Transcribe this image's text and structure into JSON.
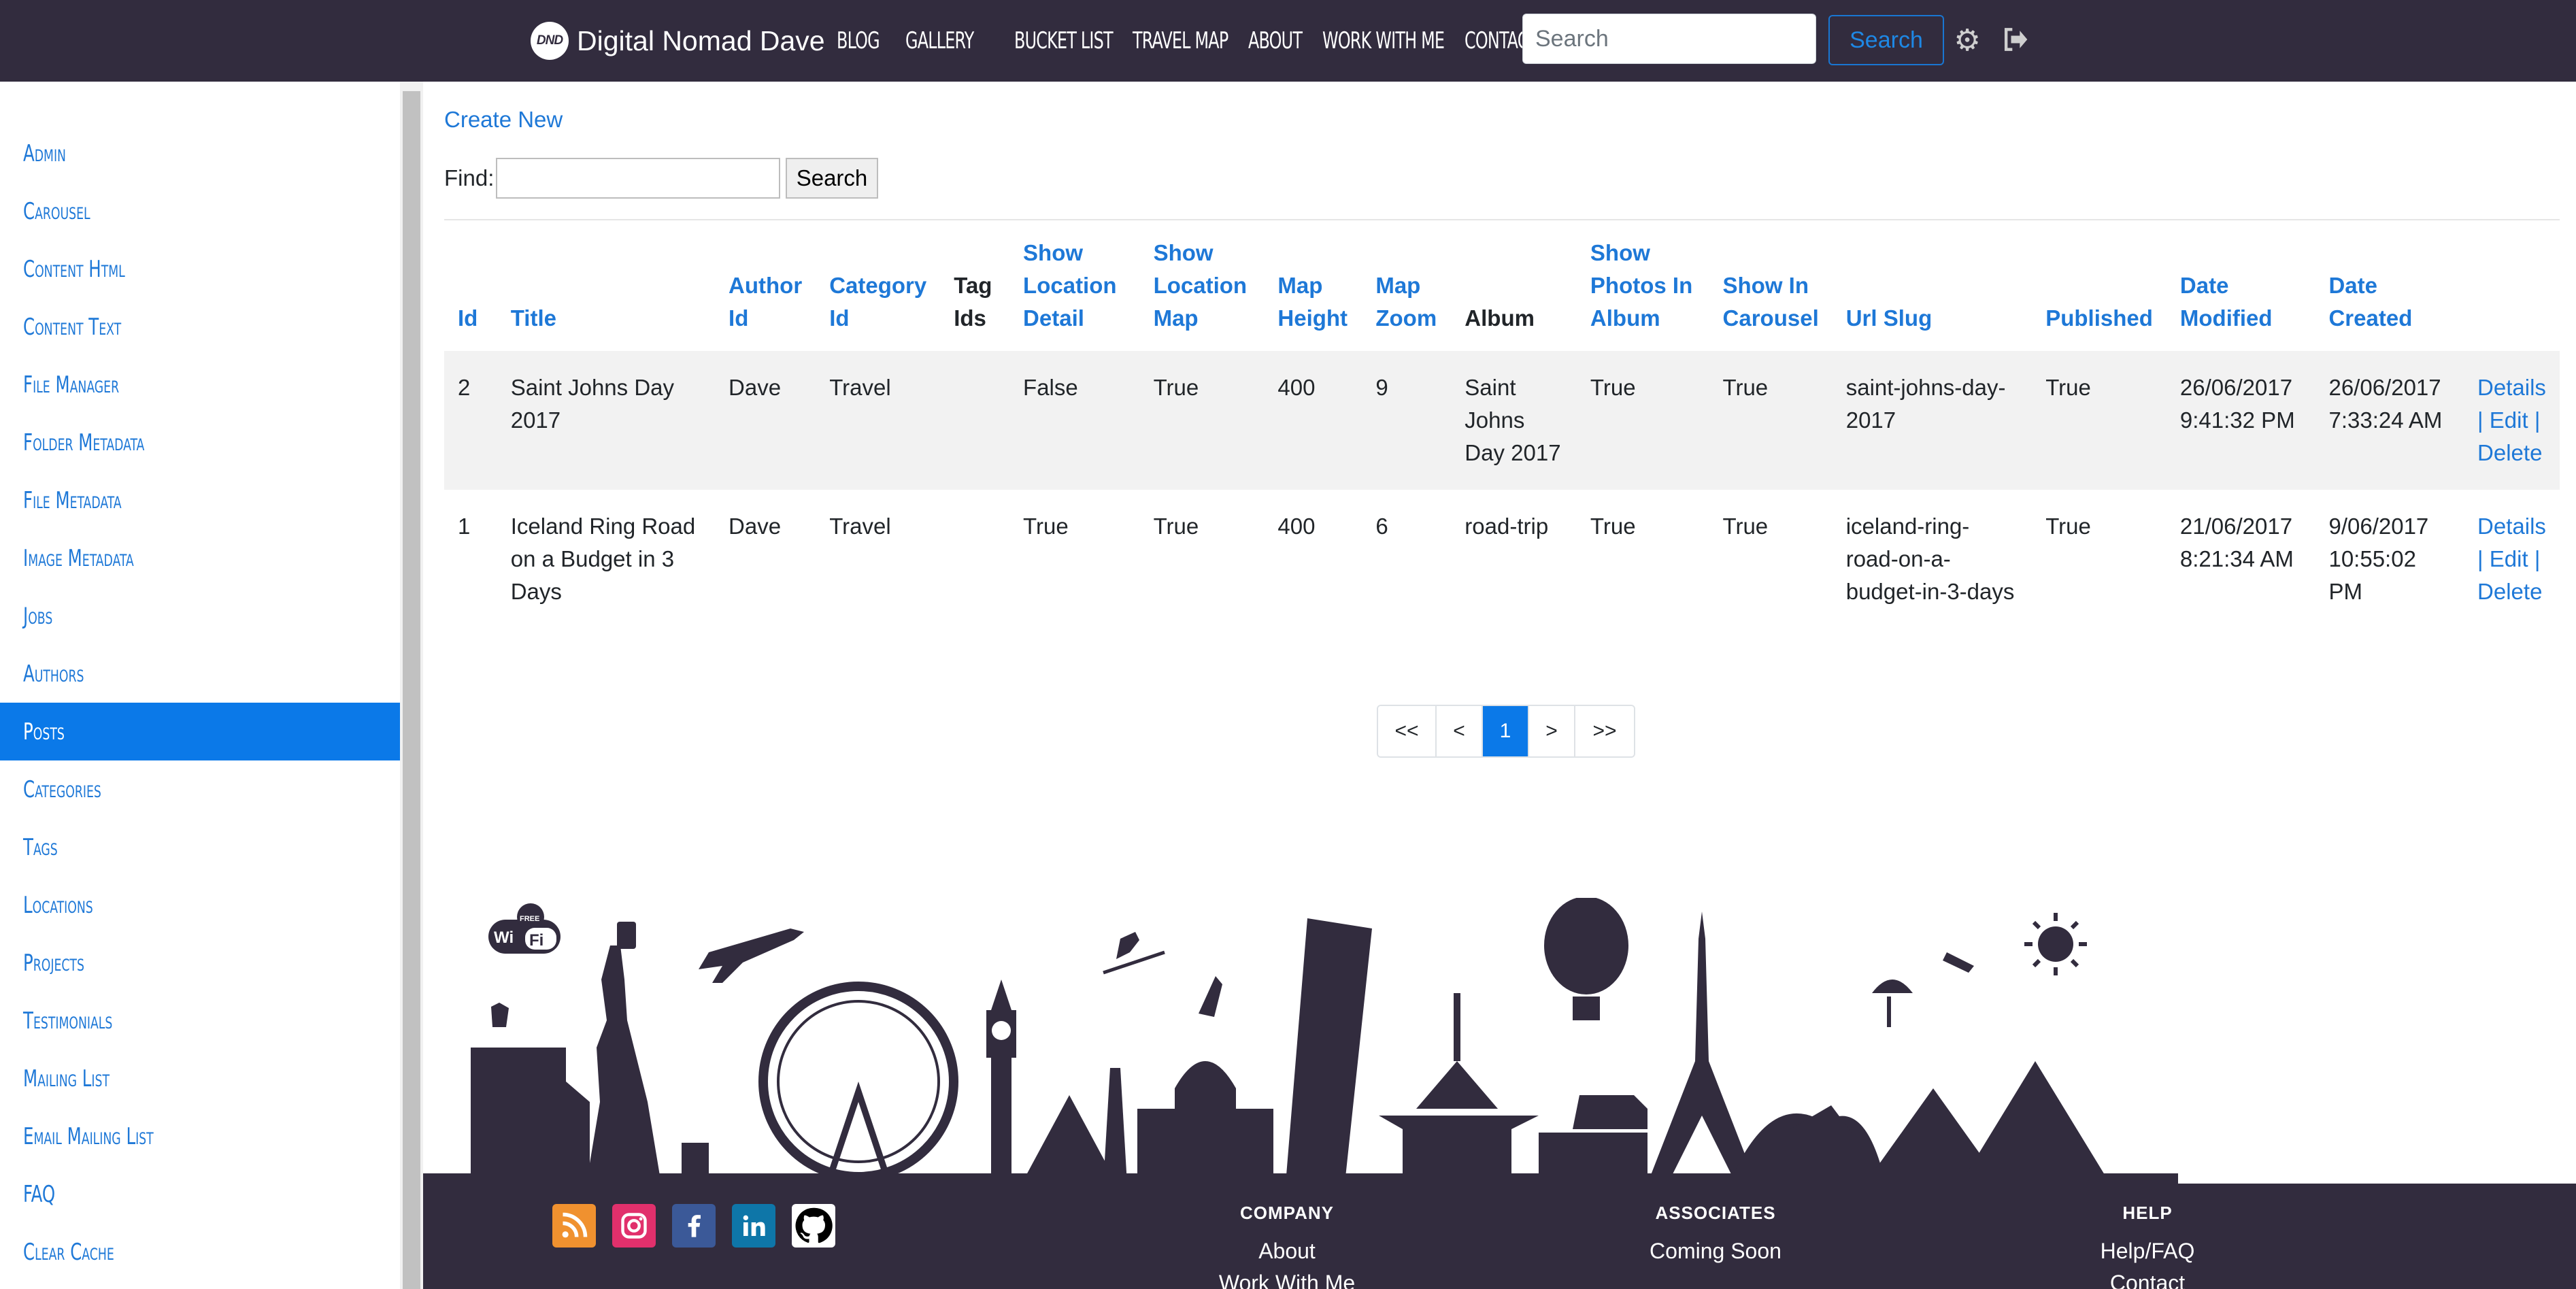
{
  "brand": {
    "logo_text": "DND",
    "name": "Digital Nomad Dave"
  },
  "nav": {
    "links": [
      "BLOG",
      "GALLERY",
      "BUCKET LIST",
      "TRAVEL MAP",
      "ABOUT",
      "WORK WITH ME",
      "CONTACT"
    ],
    "search_placeholder": "Search",
    "search_button": "Search",
    "settings_icon": "gear-icon",
    "logout_icon": "sign-out-icon"
  },
  "sidebar": {
    "items": [
      {
        "label": "Admin"
      },
      {
        "label": "Carousel"
      },
      {
        "label": "Content Html"
      },
      {
        "label": "Content Text"
      },
      {
        "label": "File Manager"
      },
      {
        "label": "Folder Metadata"
      },
      {
        "label": "File Metadata"
      },
      {
        "label": "Image Metadata"
      },
      {
        "label": "Jobs"
      },
      {
        "label": "Authors"
      },
      {
        "label": "Posts"
      },
      {
        "label": "Categories"
      },
      {
        "label": "Tags"
      },
      {
        "label": "Locations"
      },
      {
        "label": "Projects"
      },
      {
        "label": "Testimonials"
      },
      {
        "label": "Mailing List"
      },
      {
        "label": "Email Mailing List"
      },
      {
        "label": "FAQ"
      },
      {
        "label": "Clear Cache"
      }
    ],
    "active": "Posts"
  },
  "main": {
    "create_link": "Create New",
    "find_label": "Find:",
    "find_value": "",
    "find_button": "Search",
    "table": {
      "headers": [
        "Id",
        "Title",
        "Author Id",
        "Category Id",
        "Tag Ids",
        "Show Location Detail",
        "Show Location Map",
        "Map Height",
        "Map Zoom",
        "Album",
        "Show Photos In Album",
        "Show In Carousel",
        "Url Slug",
        "Published",
        "Date Modified",
        "Date Created"
      ],
      "rows": [
        {
          "id": "2",
          "title": "Saint Johns Day 2017",
          "author": "Dave",
          "category": "Travel",
          "tags": "",
          "show_location_detail": "False",
          "show_location_map": "True",
          "map_height": "400",
          "map_zoom": "9",
          "album": "Saint Johns Day 2017",
          "show_photos": "True",
          "show_carousel": "True",
          "slug": "saint-johns-day-2017",
          "published": "True",
          "date_modified": "26/06/2017 9:41:32 PM",
          "date_created": "26/06/2017 7:33:24 AM"
        },
        {
          "id": "1",
          "title": "Iceland Ring Road on a Budget in 3 Days",
          "author": "Dave",
          "category": "Travel",
          "tags": "",
          "show_location_detail": "True",
          "show_location_map": "True",
          "map_height": "400",
          "map_zoom": "6",
          "album": "road-trip",
          "show_photos": "True",
          "show_carousel": "True",
          "slug": "iceland-ring-road-on-a-budget-in-3-days",
          "published": "True",
          "date_modified": "21/06/2017 8:21:34 AM",
          "date_created": "9/06/2017 10:55:02 PM"
        }
      ],
      "actions": {
        "details": "Details",
        "edit": "Edit",
        "delete": "Delete",
        "separator": "|"
      }
    },
    "pager": {
      "first": "<<",
      "prev": "<",
      "current": "1",
      "next": ">",
      "last": ">>"
    }
  },
  "footer": {
    "social": [
      {
        "name": "rss-icon",
        "color": "#f0912f"
      },
      {
        "name": "instagram-icon",
        "color": "#e1306c"
      },
      {
        "name": "facebook-icon",
        "color": "#3b5998"
      },
      {
        "name": "linkedin-icon",
        "color": "#0e76a8"
      },
      {
        "name": "github-icon",
        "color": "#000000"
      }
    ],
    "wifi_badge": {
      "top": "FREE",
      "left": "Wi",
      "right": "Fi"
    },
    "columns": [
      {
        "heading": "COMPANY",
        "links": [
          "About",
          "Work With Me"
        ]
      },
      {
        "heading": "ASSOCIATES",
        "links": [
          "Coming Soon"
        ]
      },
      {
        "heading": "HELP",
        "links": [
          "Help/FAQ",
          "Contact"
        ]
      }
    ]
  },
  "colors": {
    "navbar": "#322c3e",
    "accent": "#0b79e8",
    "link": "#1e78d7"
  }
}
